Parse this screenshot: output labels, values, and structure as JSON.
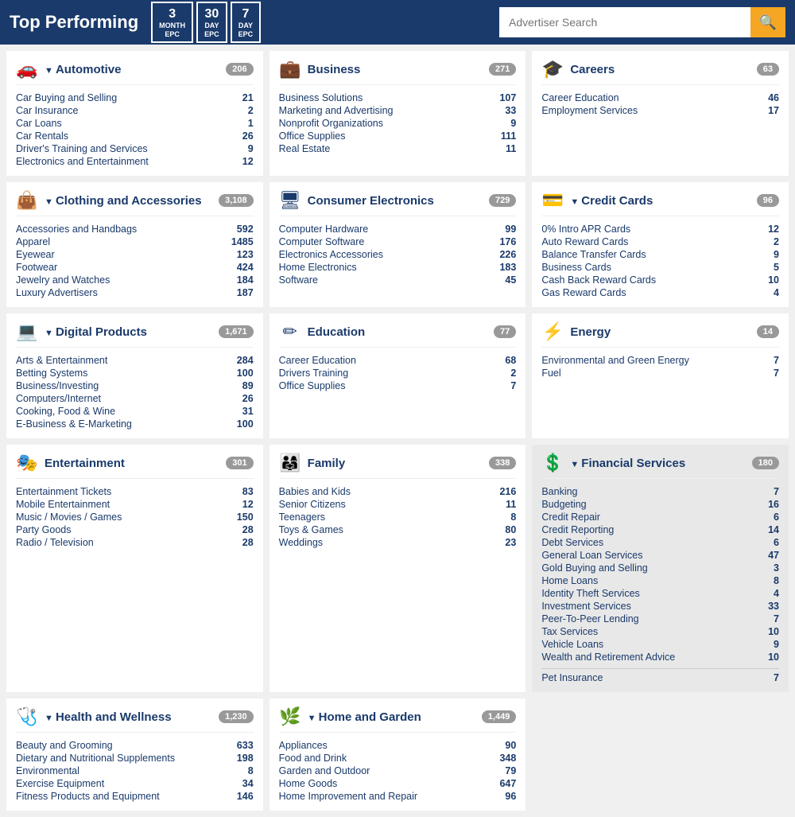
{
  "header": {
    "title": "Top Performing",
    "epc_buttons": [
      {
        "num": "3",
        "label": "MONTH EPC"
      },
      {
        "num": "30",
        "label": "DAY EPC"
      },
      {
        "num": "7",
        "label": "DAY EPC"
      }
    ],
    "search_placeholder": "Advertiser Search"
  },
  "categories": [
    {
      "id": "automotive",
      "icon": "🚗",
      "title": "Automotive",
      "expandable": true,
      "count": "206",
      "items": [
        {
          "label": "Car Buying and Selling",
          "value": "21"
        },
        {
          "label": "Car Insurance",
          "value": "2"
        },
        {
          "label": "Car Loans",
          "value": "1"
        },
        {
          "label": "Car Rentals",
          "value": "26"
        },
        {
          "label": "Driver's Training and Services",
          "value": "9"
        },
        {
          "label": "Electronics and Entertainment",
          "value": "12"
        }
      ]
    },
    {
      "id": "business",
      "icon": "💼",
      "title": "Business",
      "expandable": false,
      "count": "271",
      "items": [
        {
          "label": "Business Solutions",
          "value": "107"
        },
        {
          "label": "Marketing and Advertising",
          "value": "33"
        },
        {
          "label": "Nonprofit Organizations",
          "value": "9"
        },
        {
          "label": "Office Supplies",
          "value": "111"
        },
        {
          "label": "Real Estate",
          "value": "11"
        }
      ]
    },
    {
      "id": "careers",
      "icon": "🎓",
      "title": "Careers",
      "expandable": false,
      "count": "63",
      "items": [
        {
          "label": "Career Education",
          "value": "46"
        },
        {
          "label": "Employment Services",
          "value": "17"
        }
      ]
    },
    {
      "id": "clothing",
      "icon": "👜",
      "title": "Clothing and Accessories",
      "expandable": true,
      "count": "3,108",
      "items": [
        {
          "label": "Accessories and Handbags",
          "value": "592"
        },
        {
          "label": "Apparel",
          "value": "1485"
        },
        {
          "label": "Eyewear",
          "value": "123"
        },
        {
          "label": "Footwear",
          "value": "424"
        },
        {
          "label": "Jewelry and Watches",
          "value": "184"
        },
        {
          "label": "Luxury Advertisers",
          "value": "187"
        }
      ]
    },
    {
      "id": "consumer-electronics",
      "icon": "🖥️",
      "title": "Consumer Electronics",
      "expandable": false,
      "count": "729",
      "items": [
        {
          "label": "Computer Hardware",
          "value": "99"
        },
        {
          "label": "Computer Software",
          "value": "176"
        },
        {
          "label": "Electronics Accessories",
          "value": "226"
        },
        {
          "label": "Home Electronics",
          "value": "183"
        },
        {
          "label": "Software",
          "value": "45"
        }
      ]
    },
    {
      "id": "credit-cards",
      "icon": "💳",
      "title": "Credit Cards",
      "expandable": true,
      "count": "96",
      "items": [
        {
          "label": "0% Intro APR Cards",
          "value": "12"
        },
        {
          "label": "Auto Reward Cards",
          "value": "2"
        },
        {
          "label": "Balance Transfer Cards",
          "value": "9"
        },
        {
          "label": "Business Cards",
          "value": "5"
        },
        {
          "label": "Cash Back Reward Cards",
          "value": "10"
        },
        {
          "label": "Gas Reward Cards",
          "value": "4"
        }
      ]
    },
    {
      "id": "digital-products",
      "icon": "💻",
      "title": "Digital Products",
      "expandable": true,
      "count": "1,671",
      "items": [
        {
          "label": "Arts & Entertainment",
          "value": "284"
        },
        {
          "label": "Betting Systems",
          "value": "100"
        },
        {
          "label": "Business/Investing",
          "value": "89"
        },
        {
          "label": "Computers/Internet",
          "value": "26"
        },
        {
          "label": "Cooking, Food & Wine",
          "value": "31"
        },
        {
          "label": "E-Business & E-Marketing",
          "value": "100"
        }
      ]
    },
    {
      "id": "education",
      "icon": "✏️",
      "title": "Education",
      "expandable": false,
      "count": "77",
      "items": [
        {
          "label": "Career Education",
          "value": "68"
        },
        {
          "label": "Drivers Training",
          "value": "2"
        },
        {
          "label": "Office Supplies",
          "value": "7"
        }
      ]
    },
    {
      "id": "energy",
      "icon": "⚡",
      "title": "Energy",
      "expandable": false,
      "count": "14",
      "items": [
        {
          "label": "Environmental and Green Energy",
          "value": "7"
        },
        {
          "label": "Fuel",
          "value": "7"
        }
      ]
    },
    {
      "id": "entertainment",
      "icon": "🎭",
      "title": "Entertainment",
      "expandable": false,
      "count": "301",
      "items": [
        {
          "label": "Entertainment Tickets",
          "value": "83"
        },
        {
          "label": "Mobile Entertainment",
          "value": "12"
        },
        {
          "label": "Music / Movies / Games",
          "value": "150"
        },
        {
          "label": "Party Goods",
          "value": "28"
        },
        {
          "label": "Radio / Television",
          "value": "28"
        }
      ]
    },
    {
      "id": "family",
      "icon": "👨‍👩‍👧",
      "title": "Family",
      "expandable": false,
      "count": "338",
      "items": [
        {
          "label": "Babies and Kids",
          "value": "216"
        },
        {
          "label": "Senior Citizens",
          "value": "11"
        },
        {
          "label": "Teenagers",
          "value": "8"
        },
        {
          "label": "Toys & Games",
          "value": "80"
        },
        {
          "label": "Weddings",
          "value": "23"
        }
      ]
    },
    {
      "id": "financial-services",
      "icon": "💰",
      "title": "Financial Services",
      "expandable": true,
      "highlighted": true,
      "count": "180",
      "items": [
        {
          "label": "Banking",
          "value": "7"
        },
        {
          "label": "Budgeting",
          "value": "16"
        },
        {
          "label": "Credit Repair",
          "value": "6"
        },
        {
          "label": "Credit Reporting",
          "value": "14"
        },
        {
          "label": "Debt Services",
          "value": "6"
        },
        {
          "label": "General Loan Services",
          "value": "47"
        },
        {
          "label": "Gold Buying and Selling",
          "value": "3"
        },
        {
          "label": "Home Loans",
          "value": "8"
        },
        {
          "label": "Identity Theft Services",
          "value": "4"
        },
        {
          "label": "Investment Services",
          "value": "33"
        },
        {
          "label": "Peer-To-Peer Lending",
          "value": "7"
        },
        {
          "label": "Tax Services",
          "value": "10"
        },
        {
          "label": "Vehicle Loans",
          "value": "9"
        },
        {
          "label": "Wealth and Retirement Advice",
          "value": "10"
        }
      ]
    },
    {
      "id": "health-wellness",
      "icon": "❤️",
      "title": "Health and Wellness",
      "expandable": true,
      "count": "1,230",
      "items": [
        {
          "label": "Beauty and Grooming",
          "value": "633"
        },
        {
          "label": "Dietary and Nutritional Supplements",
          "value": "198"
        },
        {
          "label": "Environmental",
          "value": "8"
        },
        {
          "label": "Exercise Equipment",
          "value": "34"
        },
        {
          "label": "Fitness Products and Equipment",
          "value": "146"
        }
      ]
    },
    {
      "id": "home-garden",
      "icon": "🌿",
      "title": "Home and Garden",
      "expandable": true,
      "count": "1,449",
      "items": [
        {
          "label": "Appliances",
          "value": "90"
        },
        {
          "label": "Food and Drink",
          "value": "348"
        },
        {
          "label": "Garden and Outdoor",
          "value": "79"
        },
        {
          "label": "Home Goods",
          "value": "647"
        },
        {
          "label": "Home Improvement and Repair",
          "value": "96"
        }
      ]
    },
    {
      "id": "pet-insurance",
      "icon": "🐾",
      "title": "Pet Insurance",
      "expandable": false,
      "count": "",
      "items": [
        {
          "label": "Pet Insurance",
          "value": "7"
        }
      ]
    }
  ]
}
